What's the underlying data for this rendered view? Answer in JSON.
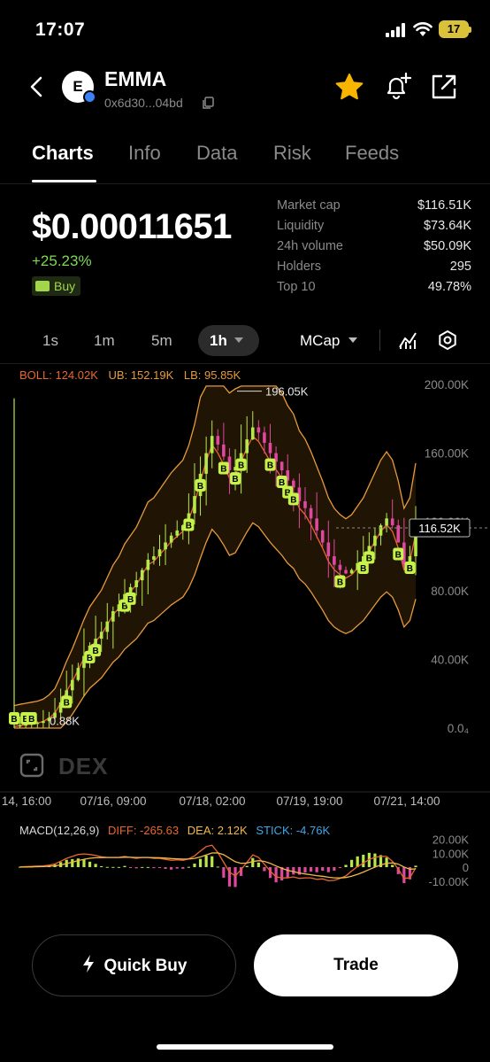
{
  "status_bar": {
    "time": "17:07",
    "battery": "17"
  },
  "header": {
    "token_name": "EMMA",
    "avatar_letter": "E",
    "address": "0x6d30...04bd"
  },
  "tabs": [
    "Charts",
    "Info",
    "Data",
    "Risk",
    "Feeds"
  ],
  "active_tab": "Charts",
  "price": {
    "value": "$0.00011651",
    "change": "+25.23%",
    "badge": "Buy"
  },
  "stats": [
    {
      "label": "Market cap",
      "value": "$116.51K"
    },
    {
      "label": "Liquidity",
      "value": "$73.64K"
    },
    {
      "label": "24h volume",
      "value": "$50.09K"
    },
    {
      "label": "Holders",
      "value": "295"
    },
    {
      "label": "Top 10",
      "value": "49.78%"
    }
  ],
  "intervals": [
    "1s",
    "1m",
    "5m",
    "1h"
  ],
  "active_interval": "1h",
  "metric_select": "MCap",
  "boll_legend": {
    "boll": "BOLL: 124.02K",
    "ub": "UB: 152.19K",
    "lb": "LB: 95.85K"
  },
  "macd_legend": {
    "label": "MACD(12,26,9)",
    "diff": "DIFF: -265.63",
    "dea": "DEA: 2.12K",
    "stick": "STICK: -4.76K"
  },
  "watermark": "DEX",
  "colors": {
    "up": "#b6e84a",
    "down": "#e0479e",
    "boll_mid": "#e8672c",
    "boll_band": "#e69a3c",
    "diff": "#e8672c",
    "dea": "#f2b84b",
    "stick_label": "#3fa7e8",
    "marker": "#c6f24a"
  },
  "chart_data": {
    "type": "candlestick",
    "y_axis": {
      "ticks": [
        "200.00K",
        "160.00K",
        "120.00K",
        "80.00K",
        "40.00K",
        "0.0₄"
      ],
      "ylim": [
        0,
        200000
      ]
    },
    "x_axis": {
      "ticks": [
        "14, 16:00",
        "07/16, 09:00",
        "07/18, 02:00",
        "07/19, 19:00",
        "07/21, 14:00"
      ]
    },
    "high_label": "196.05K",
    "low_label": "0.88K",
    "current_label": "116.52K",
    "current_value": 116520,
    "close_series": [
      900,
      1500,
      2000,
      2500,
      3000,
      4000,
      6000,
      9000,
      15000,
      22000,
      28000,
      35000,
      42000,
      48000,
      52000,
      56000,
      62000,
      68000,
      72000,
      78000,
      82000,
      86000,
      92000,
      98000,
      100000,
      104000,
      108000,
      112000,
      115000,
      118000,
      125000,
      135000,
      148000,
      160000,
      170000,
      165000,
      158000,
      150000,
      152000,
      160000,
      168000,
      175000,
      172000,
      166000,
      160000,
      155000,
      150000,
      144000,
      140000,
      132000,
      128000,
      122000,
      115000,
      108000,
      100000,
      95000,
      92000,
      90000,
      92000,
      96000,
      100000,
      106000,
      112000,
      118000,
      122000,
      118000,
      108000,
      95000,
      100000,
      116520
    ],
    "macd_axis": {
      "ticks": [
        "20.00K",
        "10.00K",
        "0",
        "-10.00K"
      ]
    }
  }
}
